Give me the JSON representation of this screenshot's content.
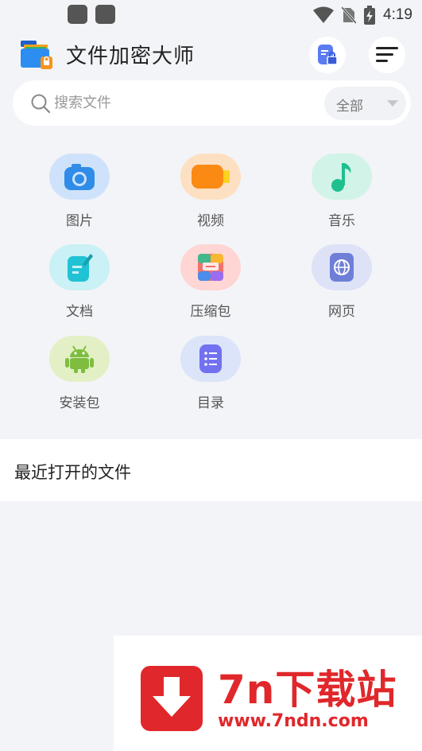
{
  "status_bar": {
    "time": "4:19"
  },
  "header": {
    "title": "文件加密大师"
  },
  "search": {
    "placeholder": "搜索文件",
    "filter_selected": "全部"
  },
  "categories": [
    {
      "label": "图片",
      "icon": "camera-icon",
      "bg": "#cfe2fb",
      "color": "#2f8ce8"
    },
    {
      "label": "视频",
      "icon": "video-icon",
      "bg": "#fde0c2",
      "color": "#fb8a14"
    },
    {
      "label": "音乐",
      "icon": "music-note-icon",
      "bg": "#d2f3e8",
      "color": "#1fbf8f"
    },
    {
      "label": "文档",
      "icon": "document-icon",
      "bg": "#c9f1f6",
      "color": "#21c2d4"
    },
    {
      "label": "压缩包",
      "icon": "archive-icon",
      "bg": "#ffd6d3",
      "color": "#f5726c"
    },
    {
      "label": "网页",
      "icon": "web-globe-icon",
      "bg": "#dde2f7",
      "color": "#6f7fd8"
    },
    {
      "label": "安装包",
      "icon": "android-icon",
      "bg": "#e3f0c5",
      "color": "#7ebd3f"
    },
    {
      "label": "目录",
      "icon": "list-directory-icon",
      "bg": "#dce4fa",
      "color": "#7271f0"
    }
  ],
  "recent": {
    "title": "最近打开的文件"
  },
  "watermark": {
    "title": "7n下载站",
    "url": "www.7ndn.com"
  }
}
